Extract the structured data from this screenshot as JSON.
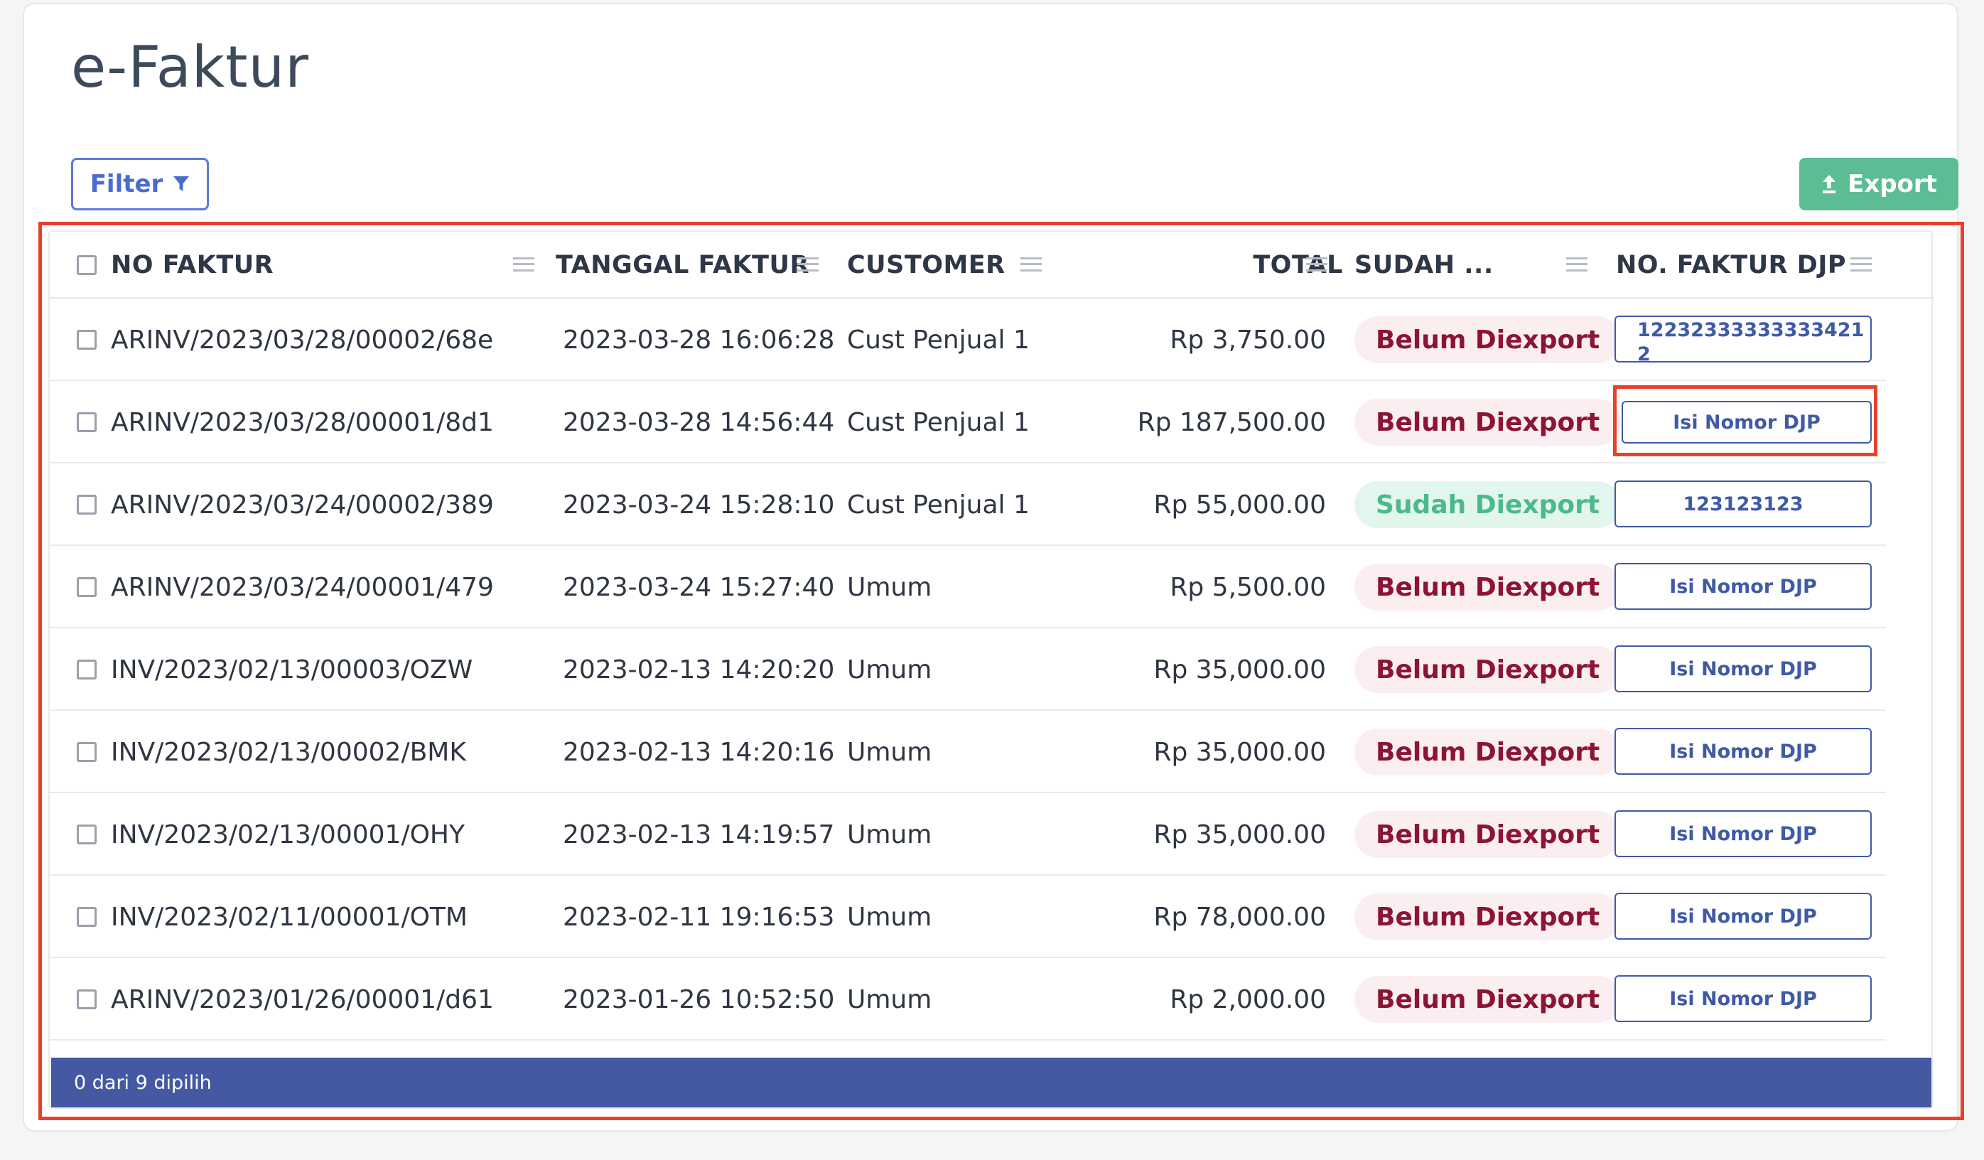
{
  "page": {
    "title": "e-Faktur",
    "filter_label": "Filter",
    "export_label": "Export"
  },
  "table": {
    "columns": {
      "no_faktur": "NO FAKTUR",
      "tanggal_faktur": "TANGGAL FAKTUR",
      "customer": "CUSTOMER",
      "total": "TOTAL",
      "sudah": "SUDAH ...",
      "no_faktur_djp": "NO. FAKTUR DJP"
    },
    "rows": [
      {
        "no_faktur": "ARINV/2023/03/28/00002/68e",
        "tanggal": "2023-03-28 16:06:28",
        "customer": "Cust Penjual 1",
        "total": "Rp 3,750.00",
        "status": "Belum Diexport",
        "djp": "122323333333334212"
      },
      {
        "no_faktur": "ARINV/2023/03/28/00001/8d1",
        "tanggal": "2023-03-28 14:56:44",
        "customer": "Cust Penjual 1",
        "total": "Rp 187,500.00",
        "status": "Belum Diexport",
        "djp": "Isi Nomor DJP"
      },
      {
        "no_faktur": "ARINV/2023/03/24/00002/389",
        "tanggal": "2023-03-24 15:28:10",
        "customer": "Cust Penjual 1",
        "total": "Rp 55,000.00",
        "status": "Sudah Diexport",
        "djp": "123123123"
      },
      {
        "no_faktur": "ARINV/2023/03/24/00001/479",
        "tanggal": "2023-03-24 15:27:40",
        "customer": "Umum",
        "total": "Rp 5,500.00",
        "status": "Belum Diexport",
        "djp": "Isi Nomor DJP"
      },
      {
        "no_faktur": "INV/2023/02/13/00003/OZW",
        "tanggal": "2023-02-13 14:20:20",
        "customer": "Umum",
        "total": "Rp 35,000.00",
        "status": "Belum Diexport",
        "djp": "Isi Nomor DJP"
      },
      {
        "no_faktur": "INV/2023/02/13/00002/BMK",
        "tanggal": "2023-02-13 14:20:16",
        "customer": "Umum",
        "total": "Rp 35,000.00",
        "status": "Belum Diexport",
        "djp": "Isi Nomor DJP"
      },
      {
        "no_faktur": "INV/2023/02/13/00001/OHY",
        "tanggal": "2023-02-13 14:19:57",
        "customer": "Umum",
        "total": "Rp 35,000.00",
        "status": "Belum Diexport",
        "djp": "Isi Nomor DJP"
      },
      {
        "no_faktur": "INV/2023/02/11/00001/OTM",
        "tanggal": "2023-02-11 19:16:53",
        "customer": "Umum",
        "total": "Rp 78,000.00",
        "status": "Belum Diexport",
        "djp": "Isi Nomor DJP"
      },
      {
        "no_faktur": "ARINV/2023/01/26/00001/d61",
        "tanggal": "2023-01-26 10:52:50",
        "customer": "Umum",
        "total": "Rp 2,000.00",
        "status": "Belum Diexport",
        "djp": "Isi Nomor DJP"
      }
    ],
    "selection_summary": "0 dari 9 dipilih"
  },
  "colors": {
    "accent": "#4459a2",
    "export_green": "#5cbd92",
    "status_belum_text": "#8c1434",
    "status_sudah_text": "#4cb98c",
    "highlight": "#e8412b"
  }
}
